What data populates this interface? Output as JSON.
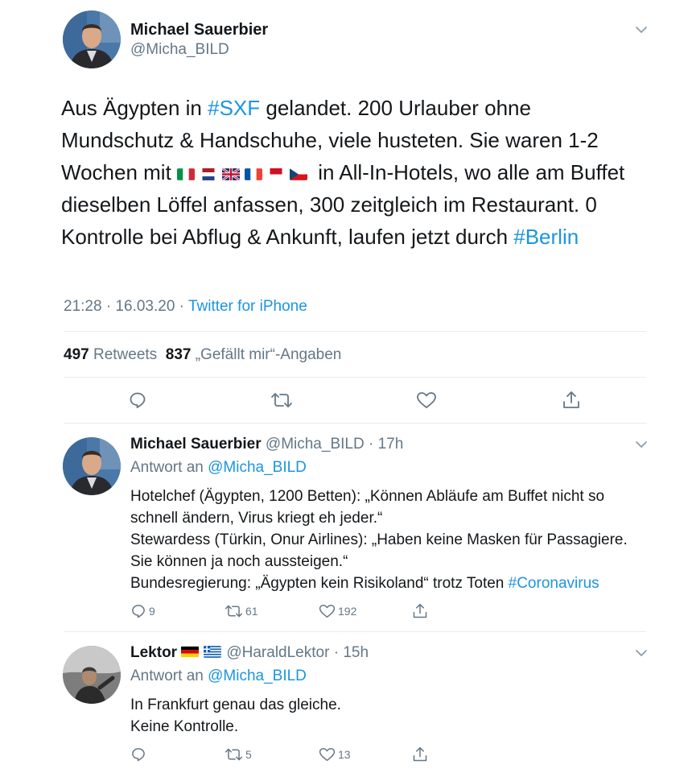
{
  "main_tweet": {
    "author_name": "Michael Sauerbier",
    "author_handle": "@Micha_BILD",
    "text_part1": "Aus Ägypten in ",
    "hashtag_sxf": "#SXF",
    "text_part2": " gelandet. 200 Urlauber ohne Mundschutz & Handschuhe, viele husteten. Sie waren 1-2 Wochen mit ",
    "flags": [
      "flag-italy",
      "flag-netherlands",
      "flag-uk",
      "flag-france",
      "flag-monaco",
      "flag-czech"
    ],
    "text_part3": " in All-In-Hotels, wo alle am Buffet dieselben Löffel anfassen, 300 zeitgleich im Restaurant. 0 Kontrolle bei Abflug & Ankunft, laufen jetzt durch ",
    "hashtag_berlin": "#Berlin",
    "time_date": "21:28 · 16.03.20 · ",
    "source": "Twitter for iPhone",
    "retweet_count": "497",
    "retweet_label": "Retweets",
    "like_count": "837",
    "like_label": "„Gefällt mir“-Angaben"
  },
  "replies": [
    {
      "author_name": "Michael Sauerbier",
      "author_handle": "@Micha_BILD",
      "time": "17h",
      "reply_to_prefix": "Antwort an ",
      "reply_to_handle": "@Micha_BILD",
      "line1": "Hotelchef (Ägypten, 1200 Betten): „Können Abläufe am Buffet nicht so schnell ändern, Virus kriegt eh jeder.“",
      "line2": "Stewardess (Türkin, Onur Airlines): „Haben keine Masken für Passagiere. Sie können ja noch aussteigen.“",
      "line3_text": "Bundesregierung: „Ägypten kein Risikoland“ trotz Toten ",
      "line3_hashtag": "#Coronavirus",
      "reply_count": "9",
      "retweet_count": "61",
      "like_count": "192"
    },
    {
      "author_name": "Lektor",
      "author_flags": [
        "flag-germany",
        "flag-greece"
      ],
      "author_handle": "@HaraldLektor",
      "time": "15h",
      "reply_to_prefix": "Antwort an ",
      "reply_to_handle": "@Micha_BILD",
      "line1": "In Frankfurt genau das gleiche.",
      "line2": "Keine Kontrolle.",
      "reply_count": "",
      "retweet_count": "5",
      "like_count": "13"
    }
  ],
  "colors": {
    "link": "#1b95e0",
    "text": "#14171a",
    "secondary": "#657786",
    "divider": "#e6ecf0"
  }
}
